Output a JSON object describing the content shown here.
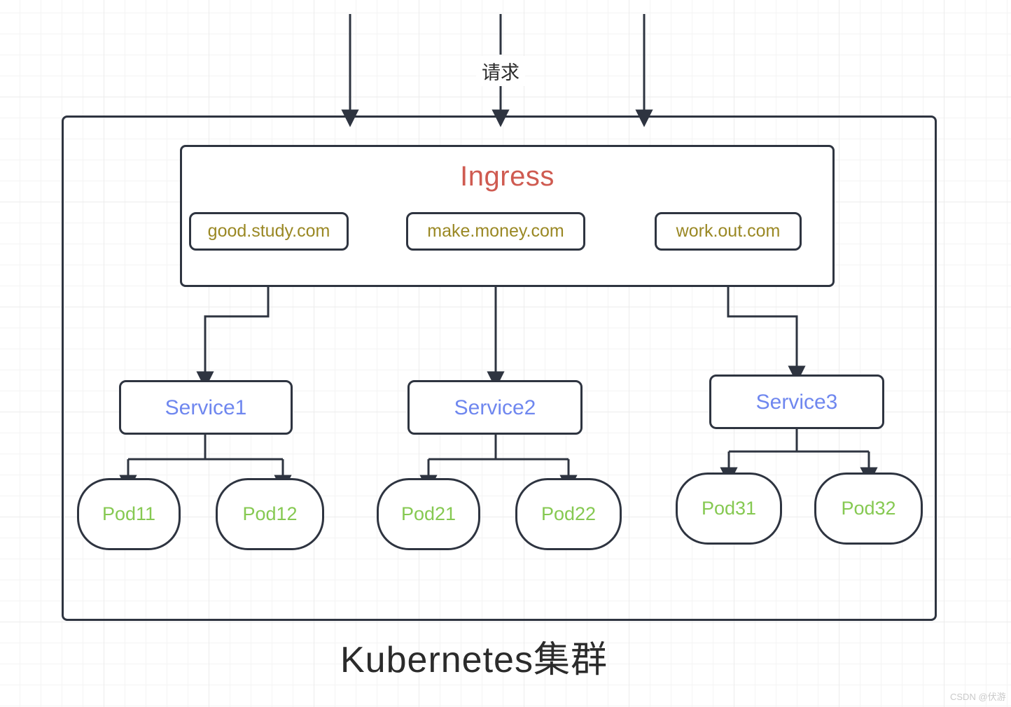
{
  "diagram": {
    "title": "Kubernetes集群",
    "request_label": "请求",
    "ingress": {
      "title": "Ingress",
      "hosts": [
        {
          "label": "good.study.com"
        },
        {
          "label": "make.money.com"
        },
        {
          "label": "work.out.com"
        }
      ]
    },
    "services": [
      {
        "label": "Service1"
      },
      {
        "label": "Service2"
      },
      {
        "label": "Service3"
      }
    ],
    "pods": [
      {
        "label": "Pod11"
      },
      {
        "label": "Pod12"
      },
      {
        "label": "Pod21"
      },
      {
        "label": "Pod22"
      },
      {
        "label": "Pod31"
      },
      {
        "label": "Pod32"
      }
    ],
    "watermark": "CSDN @伏游",
    "colors": {
      "stroke": "#2e3440",
      "ingress_text": "#cf5b51",
      "host_text": "#9a8824",
      "service_text": "#6f87ef",
      "pod_text": "#86c952",
      "title_text": "#2b2b2b",
      "grid_line": "#ececec",
      "background": "#ffffff"
    }
  }
}
